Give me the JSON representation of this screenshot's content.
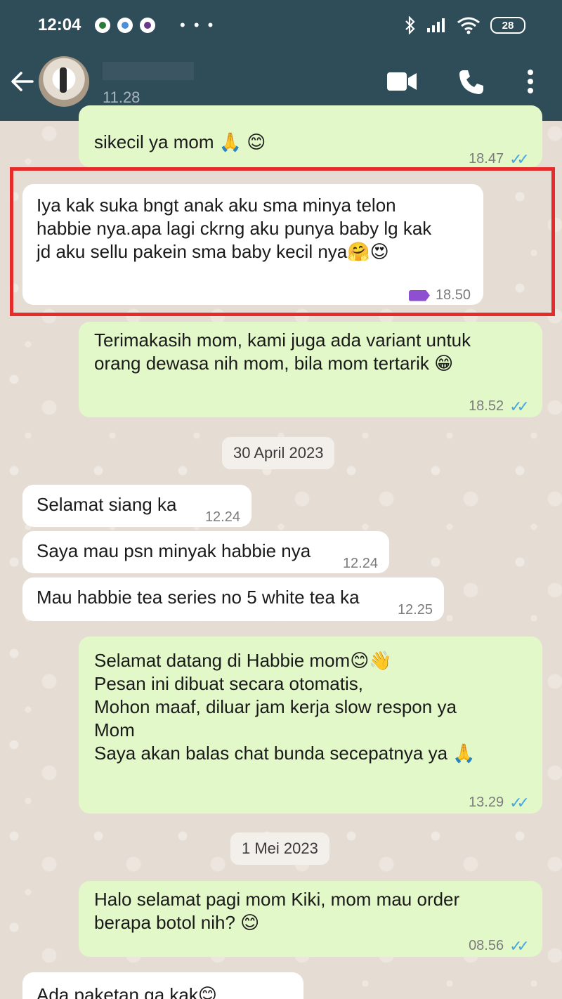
{
  "status_bar": {
    "time": "12:04",
    "notifications_more": "• • •",
    "battery": "28"
  },
  "app_bar": {
    "contact_subtitle": "11.28",
    "icons": [
      "back-arrow-icon",
      "video-call-icon",
      "voice-call-icon",
      "more-vert-icon"
    ]
  },
  "messages": [
    {
      "direction": "out",
      "text": "sikecil ya mom 🙏 😊",
      "time": "18.47",
      "status": "read"
    },
    {
      "direction": "in",
      "text": "Iya kak suka bngt anak aku sma minya telon\nhabbie nya.apa lagi ckrng aku punya baby lg kak\njd aku sellu pakein sma baby kecil nya🤗😍",
      "time": "18.50",
      "label_color": "#8e4fd0"
    },
    {
      "direction": "out",
      "text": "Terimakasih mom, kami juga ada variant untuk\norang dewasa nih mom, bila mom tertarik 😁",
      "time": "18.52",
      "status": "read"
    },
    {
      "direction": "in",
      "text": "Selamat siang ka",
      "time": "12.24"
    },
    {
      "direction": "in",
      "text": "Saya mau psn minyak habbie nya",
      "time": "12.24"
    },
    {
      "direction": "in",
      "text": "Mau habbie tea series no 5 white tea ka",
      "time": "12.25"
    },
    {
      "direction": "out",
      "text": "Selamat datang di Habbie mom😊👋\nPesan ini dibuat secara otomatis,\nMohon maaf, diluar jam kerja slow respon ya\nMom\nSaya akan balas chat bunda secepatnya ya 🙏",
      "time": "13.29",
      "status": "read"
    },
    {
      "direction": "out",
      "text": "Halo selamat pagi mom Kiki, mom mau order\nberapa botol nih? 😊",
      "time": "08.56",
      "status": "read"
    },
    {
      "direction": "in",
      "text": "Ada paketan ga kak😊",
      "time": ""
    }
  ],
  "date_separators": [
    "30 April 2023",
    "1 Mei 2023"
  ],
  "ticks": "✓✓",
  "colors": {
    "header": "#2f4c59",
    "outgoing_bubble": "#e2f8c8",
    "incoming_bubble": "#ffffff",
    "highlight_border": "#e52b2b",
    "read_ticks": "#4aa6e0"
  }
}
